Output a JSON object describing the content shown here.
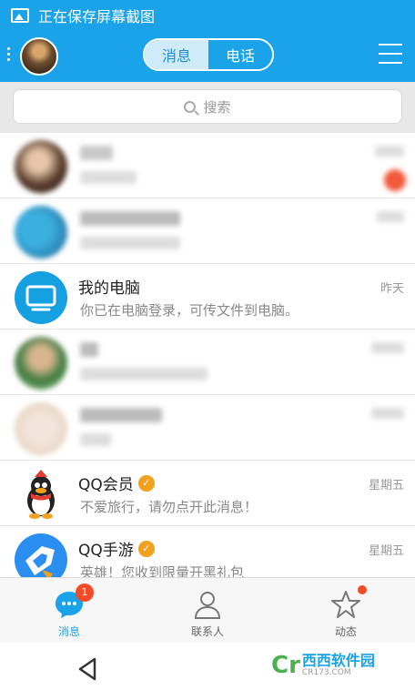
{
  "status_bar": {
    "text": "正在保存屏幕截图",
    "icon": "image-icon"
  },
  "header": {
    "tabs": [
      {
        "label": "消息",
        "active": true
      },
      {
        "label": "电话",
        "active": false
      }
    ],
    "menu_icon": "hamburger-icon"
  },
  "search": {
    "placeholder": "搜索"
  },
  "conversations": [
    {
      "name": "",
      "message": "",
      "time": "",
      "blurred": true
    },
    {
      "name": "",
      "message": "",
      "time": "",
      "blurred": true
    },
    {
      "name": "我的电脑",
      "message": "你已在电脑登录，可传文件到电脑。",
      "time": "昨天",
      "blurred": false
    },
    {
      "name": "",
      "message": "",
      "time": "",
      "blurred": true
    },
    {
      "name": "",
      "message": "",
      "time": "",
      "blurred": true
    },
    {
      "name": "QQ会员",
      "message": "不爱旅行，请勿点开此消息！",
      "time": "星期五",
      "verified": true
    },
    {
      "name": "QQ手游",
      "message": "英雄！您收到限量开黑礼包",
      "time": "星期五",
      "verified": true
    }
  ],
  "tabbar": {
    "items": [
      {
        "label": "消息",
        "badge": "1",
        "active": true
      },
      {
        "label": "联系人"
      },
      {
        "label": "动态",
        "dot": true
      }
    ]
  },
  "watermark": {
    "text": "西西软件园",
    "sub": "CR173.COM"
  },
  "colors": {
    "brand": "#1aa3e8",
    "badge": "#f44a27",
    "verified": "#f2a11c"
  }
}
